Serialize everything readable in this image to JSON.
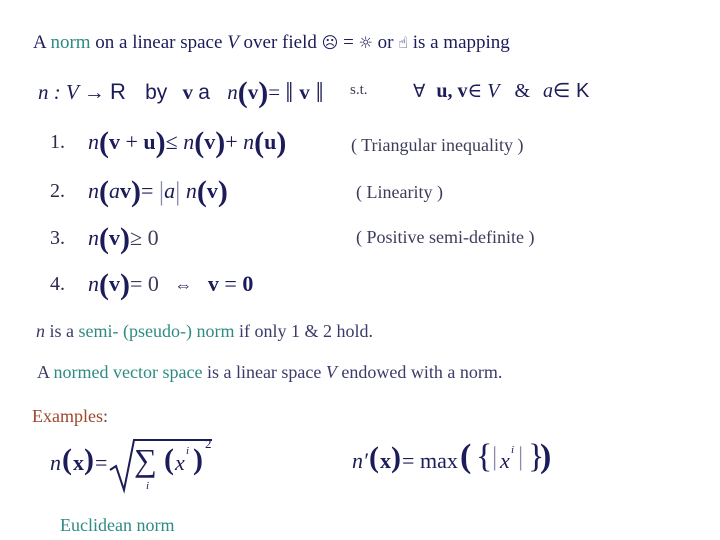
{
  "slide": {
    "intro": {
      "prefix": "A ",
      "term": "norm",
      "middle": " on a linear space ",
      "space_var": "V",
      "after_var": " over field ",
      "field_symbol_1": "☹",
      "equals": " = ",
      "field_symbol_2": "☼",
      "or": " or ",
      "field_symbol_3": "☝",
      "suffix": " is a mapping"
    },
    "mapping": {
      "n": "n",
      "colon_v": " : V ",
      "arrow": "→",
      "R": "R",
      "by": "by",
      "v": "v",
      "maps_to": "a",
      "n_of_v": "n",
      "lparen": "(",
      "v2": "v",
      "rparen": ")",
      "eq": "=",
      "norm_open": "‖",
      "v3": "v",
      "norm_close": "‖",
      "st": "s.t.",
      "forall": "∀",
      "uv": "u, v",
      "in_V": "∈ V",
      "amp": "&",
      "a": "a",
      "in_K": "∈ K"
    },
    "properties": [
      {
        "number": "1.",
        "formula": "n(v + u) ≤ n(v) + n(u)",
        "label": "( Triangular inequality )"
      },
      {
        "number": "2.",
        "formula": "n(av) = |a| n(v)",
        "label": "( Linearity )"
      },
      {
        "number": "3.",
        "formula": "n(v) ≥ 0",
        "label": "( Positive semi-definite )"
      },
      {
        "number": "4.",
        "formula": "n(v) = 0 ⇔ v = 0",
        "label": ""
      }
    ],
    "seminorm": {
      "n": "n",
      "is_a": " is a ",
      "term": "semi- (pseudo-) norm",
      "suffix": " if only 1 & 2 hold."
    },
    "normed_space": {
      "prefix": "A ",
      "term": "normed vector space",
      "middle": " is a linear space ",
      "var": "V",
      "suffix": " endowed with a norm."
    },
    "examples": {
      "title": "Examples",
      "colon": ":",
      "euclidean": {
        "lhs_n": "n",
        "lhs_x": "x",
        "eq": "=",
        "sum": "∑",
        "index": "i",
        "var": "x",
        "sup": "i",
        "power": "2",
        "caption": "Euclidean norm"
      },
      "max_norm": {
        "lhs_n": "n′",
        "lhs_x": "x",
        "eq": "=",
        "func": "max",
        "var": "x",
        "sup": "i"
      }
    }
  }
}
